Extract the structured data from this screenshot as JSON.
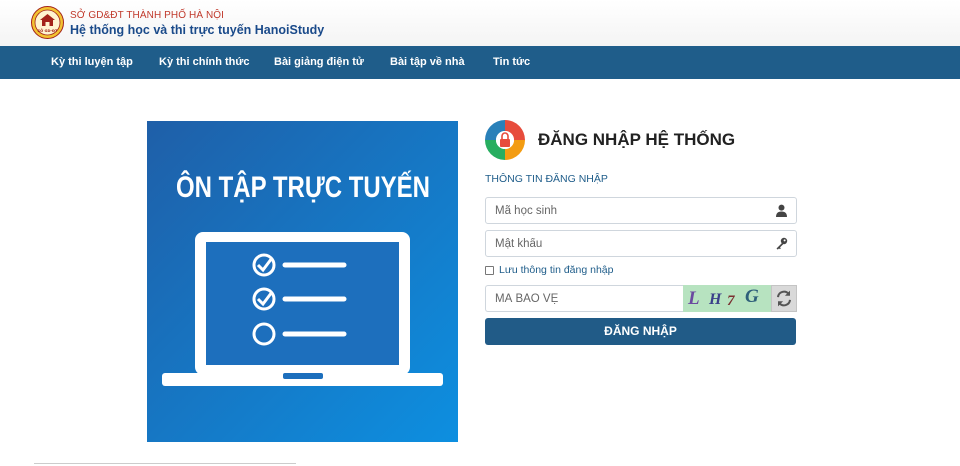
{
  "header": {
    "org_name": "SỞ GD&ĐT THÀNH PHỐ HÀ NỘI",
    "system_name": "Hệ thống học và thi trực tuyến HanoiStudy",
    "logo_text": "SỞ GD-ĐT"
  },
  "nav": {
    "items": [
      {
        "label": "Kỳ thi luyện tập"
      },
      {
        "label": "Kỳ thi chính thức"
      },
      {
        "label": "Bài giảng điện tử"
      },
      {
        "label": "Bài tập về nhà"
      },
      {
        "label": "Tin tức"
      }
    ]
  },
  "banner": {
    "title": "ÔN TẬP TRỰC TUYẾN"
  },
  "login": {
    "title": "ĐĂNG NHẬP HỆ THỐNG",
    "section_label": "THÔNG TIN ĐĂNG NHẬP",
    "student_id_placeholder": "Mã học sinh",
    "password_placeholder": "Mật khẩu",
    "remember_label": "Lưu thông tin đăng nhập",
    "captcha_placeholder": "MÃ BẢO VỆ",
    "captcha_chars": [
      "L",
      "H",
      "7",
      "G"
    ],
    "submit_label": "ĐĂNG NHẬP"
  },
  "colors": {
    "nav_bg": "#1f5d8a",
    "banner_bg": "#1a6fb8",
    "submit_bg": "#215b87",
    "org_red": "#c0392b"
  },
  "icons": {
    "student_field": "user-icon",
    "password_field": "key-icon",
    "captcha_refresh": "refresh-icon",
    "login_logo": "lock-icon"
  }
}
